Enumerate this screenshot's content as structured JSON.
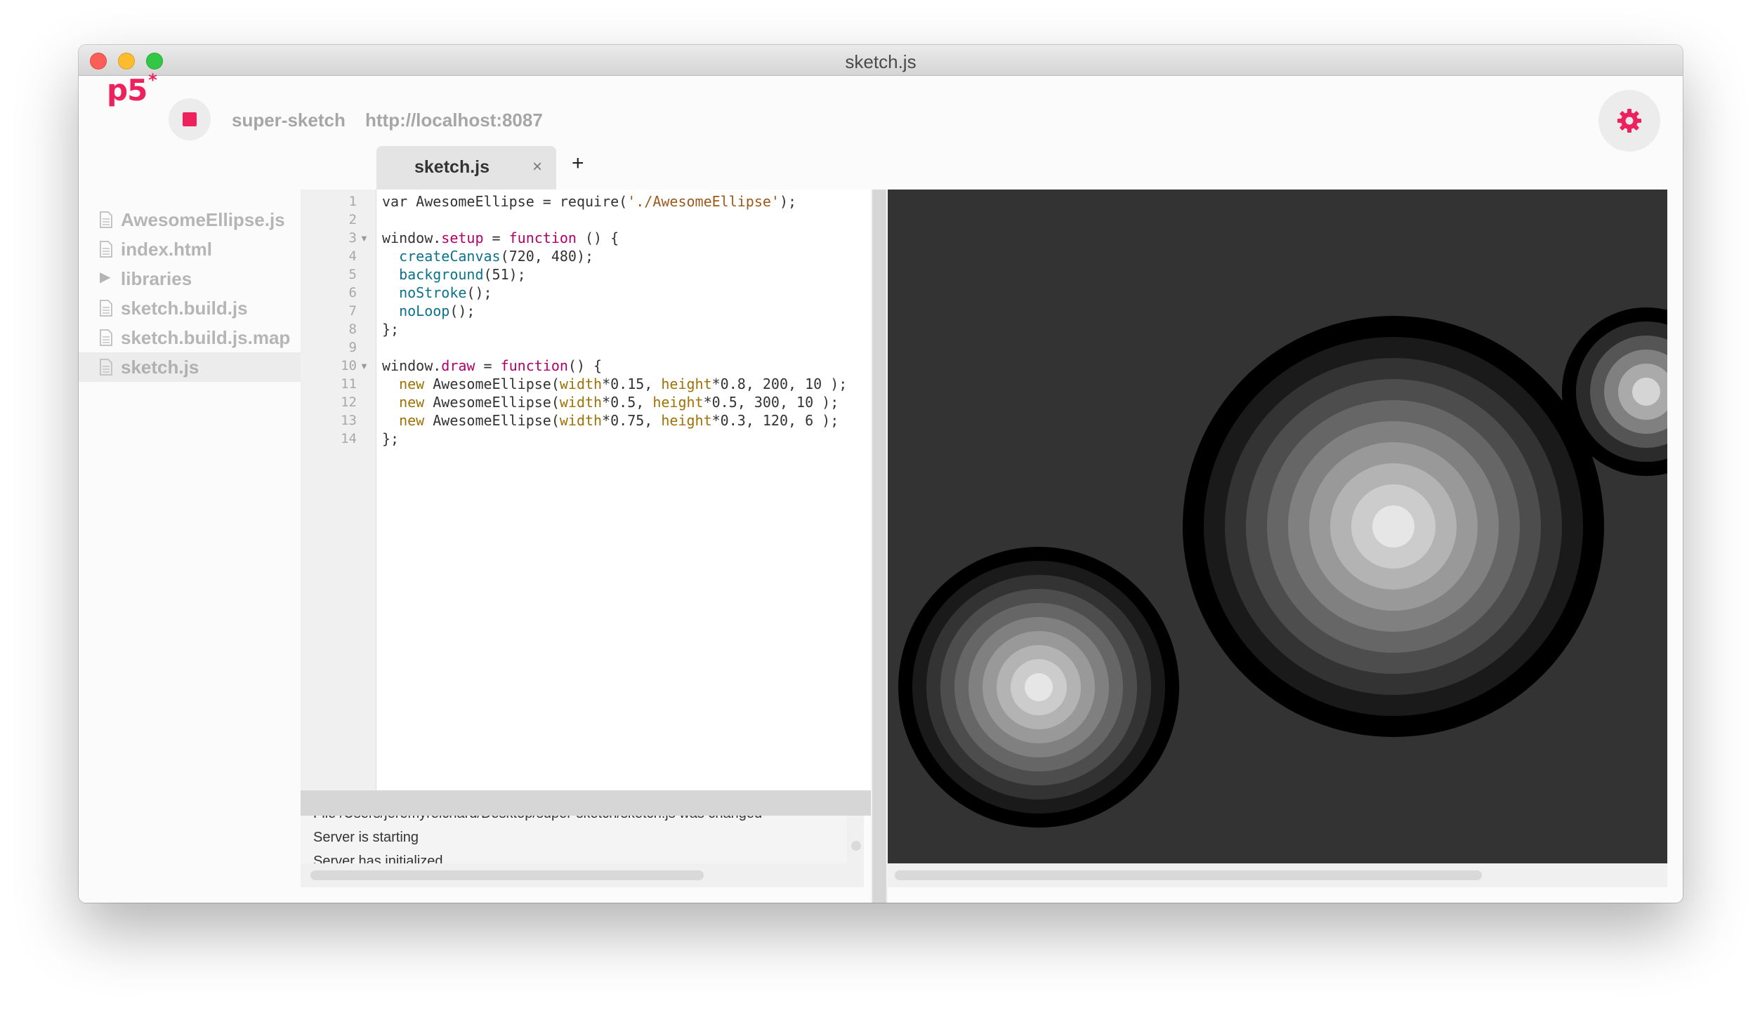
{
  "window": {
    "title": "sketch.js"
  },
  "toolbar": {
    "logo": "p5",
    "logo_mark": "*",
    "project_name": "super-sketch",
    "server_url": "http://localhost:8087",
    "stop_icon": "stop-icon",
    "settings_icon": "gear-icon"
  },
  "tabs": [
    {
      "label": "sketch.js",
      "close": "×"
    }
  ],
  "tab_add": "+",
  "sidebar": {
    "items": [
      {
        "label": "AwesomeEllipse.js",
        "type": "file"
      },
      {
        "label": "index.html",
        "type": "file"
      },
      {
        "label": "libraries",
        "type": "folder",
        "arrow": "▶"
      },
      {
        "label": "sketch.build.js",
        "type": "file"
      },
      {
        "label": "sketch.build.js.map",
        "type": "file"
      },
      {
        "label": "sketch.js",
        "type": "file",
        "active": true
      }
    ]
  },
  "editor": {
    "line_numbers": [
      "1",
      "2",
      "3",
      "4",
      "5",
      "6",
      "7",
      "8",
      "9",
      "10",
      "11",
      "12",
      "13",
      "14"
    ],
    "active_line": 14
  },
  "console": {
    "lines": [
      "File /Users/jeremyreichard/Desktop/super-sketch/sketch.js was changed",
      "Server is starting",
      "Server has initialized"
    ]
  },
  "colors": {
    "accent": "#ed225d",
    "canvas_background": "#333333"
  }
}
